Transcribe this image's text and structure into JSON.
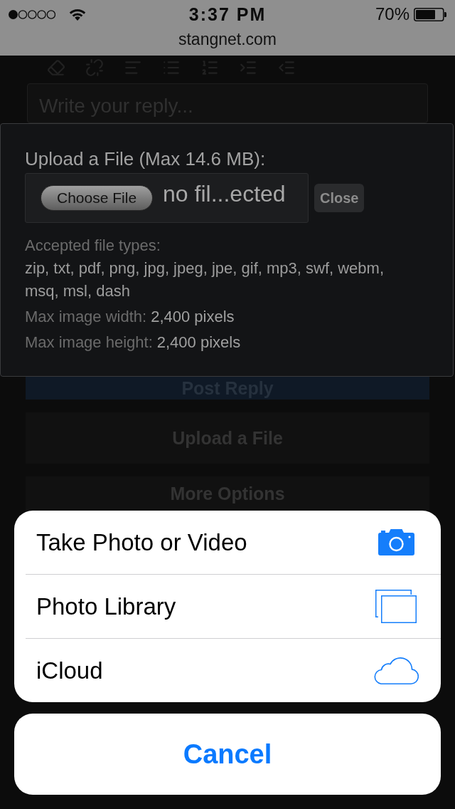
{
  "status_bar": {
    "time": "3:37 PM",
    "battery": "70%"
  },
  "address_bar": {
    "url": "stangnet.com"
  },
  "editor": {
    "placeholder": "Write your reply..."
  },
  "upload_dialog": {
    "title": "Upload a File (Max 14.6 MB):",
    "choose_button": "Choose File",
    "file_name": "no fil...ected",
    "close_button": "Close",
    "accepted_label": "Accepted file types:",
    "accepted_types": "zip, txt, pdf, png, jpg, jpeg, jpe, gif, mp3, swf, webm, msq, msl, dash",
    "limits": [
      {
        "label": "Max image width:",
        "value": "2,400 pixels"
      },
      {
        "label": "Max image height:",
        "value": "2,400 pixels"
      }
    ]
  },
  "page_buttons": [
    {
      "label": "Post Reply",
      "kind": "primary"
    },
    {
      "label": "Upload a File",
      "kind": "secondary"
    },
    {
      "label": "More Options",
      "kind": "secondary"
    }
  ],
  "action_sheet": {
    "options": [
      {
        "label": "Take Photo or Video"
      },
      {
        "label": "Photo Library"
      },
      {
        "label": "iCloud"
      }
    ],
    "cancel": "Cancel"
  }
}
